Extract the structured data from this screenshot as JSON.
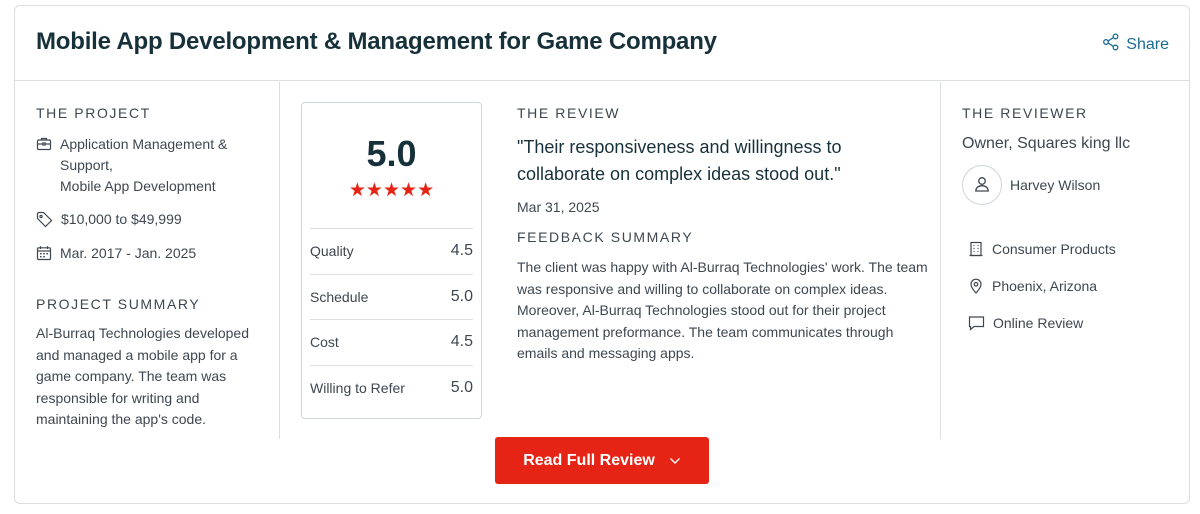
{
  "header": {
    "title": "Mobile App Development & Management for Game Company",
    "share_label": "Share"
  },
  "project": {
    "section_label": "THE PROJECT",
    "services": [
      "Application Management &",
      "Support,",
      "Mobile App Development"
    ],
    "budget": "$10,000 to $49,999",
    "dates": "Mar. 2017 - Jan. 2025",
    "summary_label": "PROJECT SUMMARY",
    "summary": "Al-Burraq Technologies developed and managed a mobile app for a game company. The team was responsible for writing and maintaining the app's code."
  },
  "rating": {
    "overall": "5.0",
    "stars": 5,
    "rows": [
      {
        "label": "Quality",
        "value": "4.5"
      },
      {
        "label": "Schedule",
        "value": "5.0"
      },
      {
        "label": "Cost",
        "value": "4.5"
      },
      {
        "label": "Willing to Refer",
        "value": "5.0"
      }
    ]
  },
  "review": {
    "section_label": "THE REVIEW",
    "quote": "\"Their responsiveness and willingness to collaborate on complex ideas stood out.\"",
    "date": "Mar 31, 2025",
    "feedback_label": "FEEDBACK SUMMARY",
    "feedback": "The client was happy with Al-Burraq Technologies' work. The team was responsive and willing to collaborate on complex ideas. Moreover, Al-Burraq Technologies stood out for their project management preformance. The team communicates through emails and messaging apps."
  },
  "reviewer": {
    "section_label": "THE REVIEWER",
    "role": "Owner, Squares king llc",
    "name": "Harvey Wilson",
    "industry": "Consumer Products",
    "location": "Phoenix, Arizona",
    "review_type": "Online Review"
  },
  "actions": {
    "read_full_review": "Read Full Review"
  },
  "colors": {
    "accent": "#e62415",
    "link": "#1b6c92",
    "heading": "#17313b"
  }
}
